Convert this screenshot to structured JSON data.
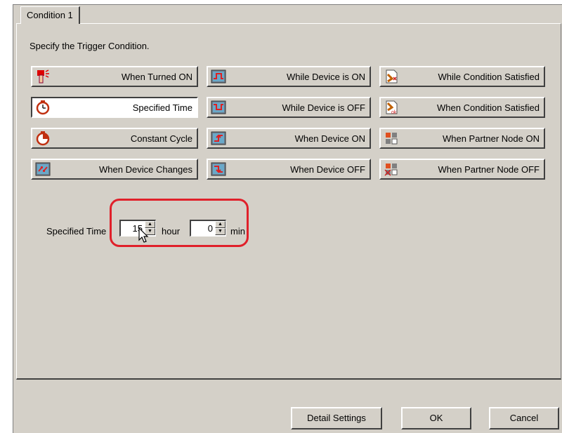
{
  "tab": {
    "label": "Condition 1"
  },
  "instruction": "Specify the Trigger Condition.",
  "triggers": [
    {
      "label": "When Turned ON",
      "icon": "hand-touch-icon"
    },
    {
      "label": "While Device is ON",
      "icon": "device-on-icon"
    },
    {
      "label": "While Condition Satisfied",
      "icon": "condition-icon"
    },
    {
      "label": "Specified Time",
      "icon": "clock-icon"
    },
    {
      "label": "While Device is OFF",
      "icon": "device-off-icon"
    },
    {
      "label": "When Condition Satisfied",
      "icon": "condition-ok-icon"
    },
    {
      "label": "Constant Cycle",
      "icon": "cycle-clock-icon"
    },
    {
      "label": "When Device ON",
      "icon": "device-rise-icon"
    },
    {
      "label": "When Partner Node ON",
      "icon": "partner-node-on-icon"
    },
    {
      "label": "When Device Changes",
      "icon": "device-change-icon"
    },
    {
      "label": "When Device OFF",
      "icon": "device-fall-icon"
    },
    {
      "label": "When Partner Node OFF",
      "icon": "partner-node-off-icon"
    }
  ],
  "selected_trigger": "Specified Time",
  "specified_time": {
    "label": "Specified Time",
    "hour_value": "15",
    "hour_unit": "hour",
    "min_value": "0",
    "min_unit": "min"
  },
  "buttons": {
    "detail": "Detail Settings",
    "ok": "OK",
    "cancel": "Cancel"
  },
  "colors": {
    "highlight": "#e0202a",
    "face": "#d4d0c8"
  }
}
